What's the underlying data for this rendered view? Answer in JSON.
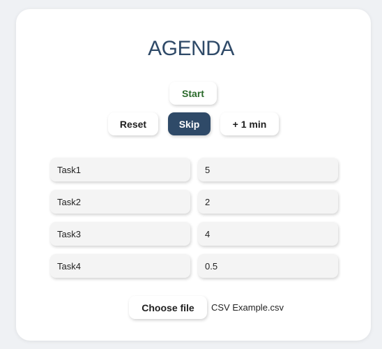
{
  "app": {
    "title": "AGENDA"
  },
  "controls": {
    "start_label": "Start",
    "reset_label": "Reset",
    "skip_label": "Skip",
    "add_minute_label": "+ 1 min"
  },
  "tasks": [
    {
      "name": "Task1",
      "duration": "5"
    },
    {
      "name": "Task2",
      "duration": "2"
    },
    {
      "name": "Task3",
      "duration": "4"
    },
    {
      "name": "Task4",
      "duration": "0.5"
    }
  ],
  "file": {
    "button_label": "Choose file",
    "selected_name": "CSV Example.csv"
  },
  "colors": {
    "accent": "#2f4a68",
    "start_text": "#2b6a2b",
    "background": "#eff1f4",
    "card": "#ffffff",
    "field": "#f4f4f4"
  }
}
